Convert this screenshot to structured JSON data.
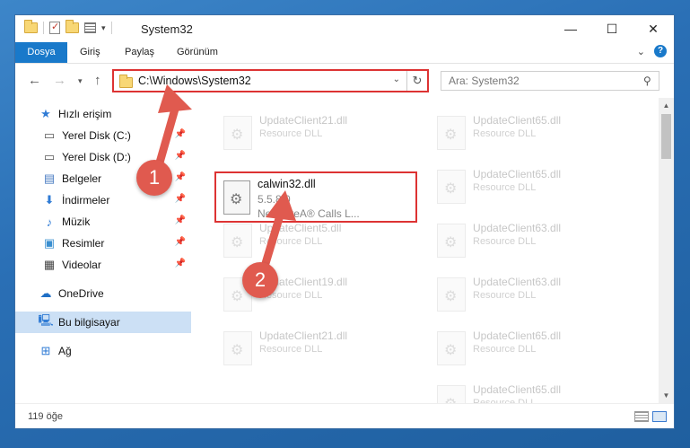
{
  "window": {
    "title": "System32",
    "controls": {
      "minimize": "—",
      "maximize": "☐",
      "close": "✕"
    }
  },
  "ribbon": {
    "tabs": [
      "Dosya",
      "Giriş",
      "Paylaş",
      "Görünüm"
    ],
    "help": "?"
  },
  "address": {
    "path": "C:\\Windows\\System32",
    "search_placeholder": "Ara: System32"
  },
  "sidebar": {
    "items": [
      {
        "label": "Hızlı erişim",
        "icon": "star-icon"
      },
      {
        "label": "Yerel Disk (C:)",
        "icon": "drive-icon"
      },
      {
        "label": "Yerel Disk (D:)",
        "icon": "drive-icon"
      },
      {
        "label": "Belgeler",
        "icon": "document-icon"
      },
      {
        "label": "İndirmeler",
        "icon": "download-icon"
      },
      {
        "label": "Müzik",
        "icon": "music-icon"
      },
      {
        "label": "Resimler",
        "icon": "pictures-icon"
      },
      {
        "label": "Videolar",
        "icon": "video-icon"
      },
      {
        "label": "OneDrive",
        "icon": "cloud-icon"
      },
      {
        "label": "Bu bilgisayar",
        "icon": "computer-icon"
      },
      {
        "label": "Ağ",
        "icon": "network-icon"
      }
    ]
  },
  "files": {
    "left": [
      {
        "name": "UpdateClient21.dll",
        "type": "Resource DLL"
      },
      {
        "name": "UpdateClient5.dll",
        "type": "Resource DLL"
      },
      {
        "name": "UpdateClient19.dll",
        "type": "Resource DLL"
      },
      {
        "name": "UpdateClient21.dll",
        "type": "Resource DLL"
      }
    ],
    "right": [
      {
        "name": "UpdateClient65.dll",
        "type": "Resource DLL"
      },
      {
        "name": "UpdateClient65.dll",
        "type": "Resource DLL"
      },
      {
        "name": "UpdateClient63.dll",
        "type": "Resource DLL"
      },
      {
        "name": "UpdateClient63.dll",
        "type": "Resource DLL"
      },
      {
        "name": "UpdateClient65.dll",
        "type": "Resource DLL"
      },
      {
        "name": "UpdateClient65.dll",
        "type": "Resource DLL"
      }
    ],
    "highlighted": {
      "name": "calwin32.dll",
      "version": "5.5.8.0",
      "description": "NetWareA® Calls L..."
    }
  },
  "status": {
    "count": "119 öğe"
  },
  "markers": {
    "one": "1",
    "two": "2"
  },
  "colors": {
    "accent": "#1979ca",
    "annotation": "#e05a4f",
    "highlight_border": "#dd3333"
  }
}
